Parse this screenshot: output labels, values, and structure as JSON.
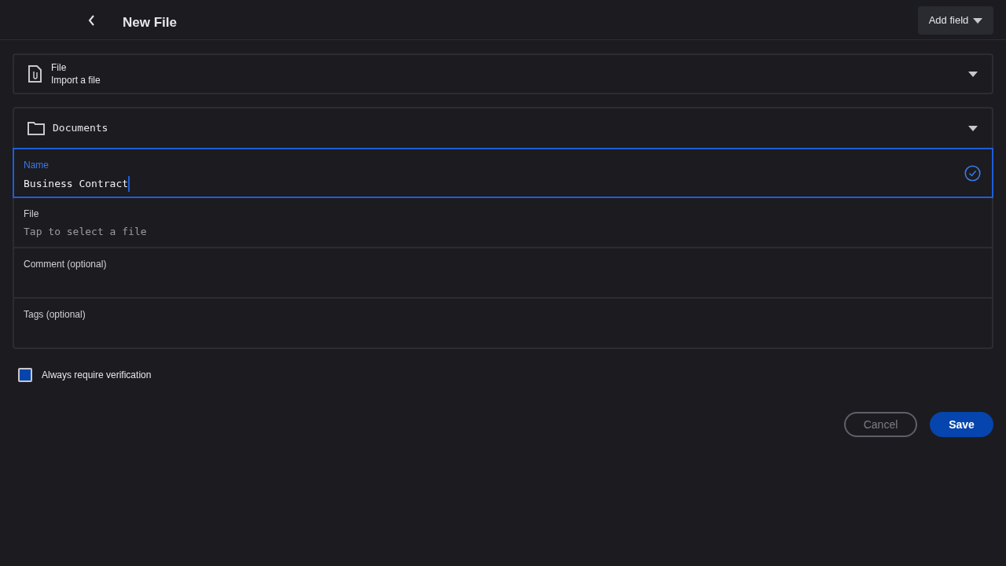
{
  "header": {
    "title": "New File",
    "add_field": "Add field"
  },
  "file_type": {
    "title": "File",
    "subtitle": "Import a file"
  },
  "folder": {
    "name": "Documents"
  },
  "fields": [
    {
      "label": "Name",
      "value": "Business Contract",
      "focused": true,
      "valid": true
    },
    {
      "label": "File",
      "placeholder": "Tap to select a file",
      "focused": false,
      "valid": false
    },
    {
      "label": "Comment (optional)",
      "focused": false,
      "valid": false
    },
    {
      "label": "Tags (optional)",
      "focused": false,
      "valid": false
    }
  ],
  "verification": {
    "label": "Always require verification",
    "checked": true
  },
  "buttons": {
    "cancel": "Cancel",
    "save": "Save"
  }
}
